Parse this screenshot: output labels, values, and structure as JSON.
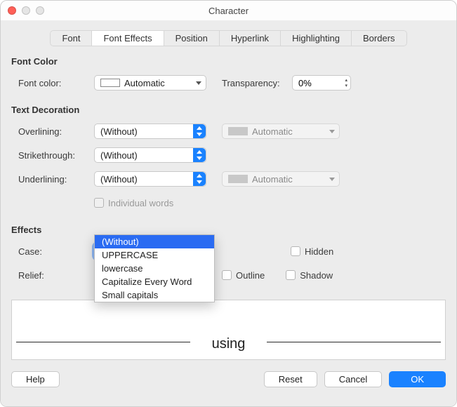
{
  "window": {
    "title": "Character"
  },
  "tabs": [
    "Font",
    "Font Effects",
    "Position",
    "Hyperlink",
    "Highlighting",
    "Borders"
  ],
  "active_tab_index": 1,
  "sections": {
    "font_color_title": "Font Color",
    "text_decoration_title": "Text Decoration",
    "effects_title": "Effects"
  },
  "labels": {
    "font_color": "Font color:",
    "transparency": "Transparency:",
    "overlining": "Overlining:",
    "strikethrough": "Strikethrough:",
    "underlining": "Underlining:",
    "individual_words": "Individual words",
    "case": "Case:",
    "relief": "Relief:",
    "hidden": "Hidden",
    "outline": "Outline",
    "shadow": "Shadow"
  },
  "values": {
    "font_color": "Automatic",
    "transparency": "0%",
    "overlining": "(Without)",
    "overlining_color": "Automatic",
    "strikethrough": "(Without)",
    "underlining": "(Without)",
    "underlining_color": "Automatic",
    "case_selected": "(Without)"
  },
  "case_options": [
    "(Without)",
    "UPPERCASE",
    "lowercase",
    "Capitalize Every Word",
    "Small capitals"
  ],
  "preview_text": "using",
  "buttons": {
    "help": "Help",
    "reset": "Reset",
    "cancel": "Cancel",
    "ok": "OK"
  }
}
